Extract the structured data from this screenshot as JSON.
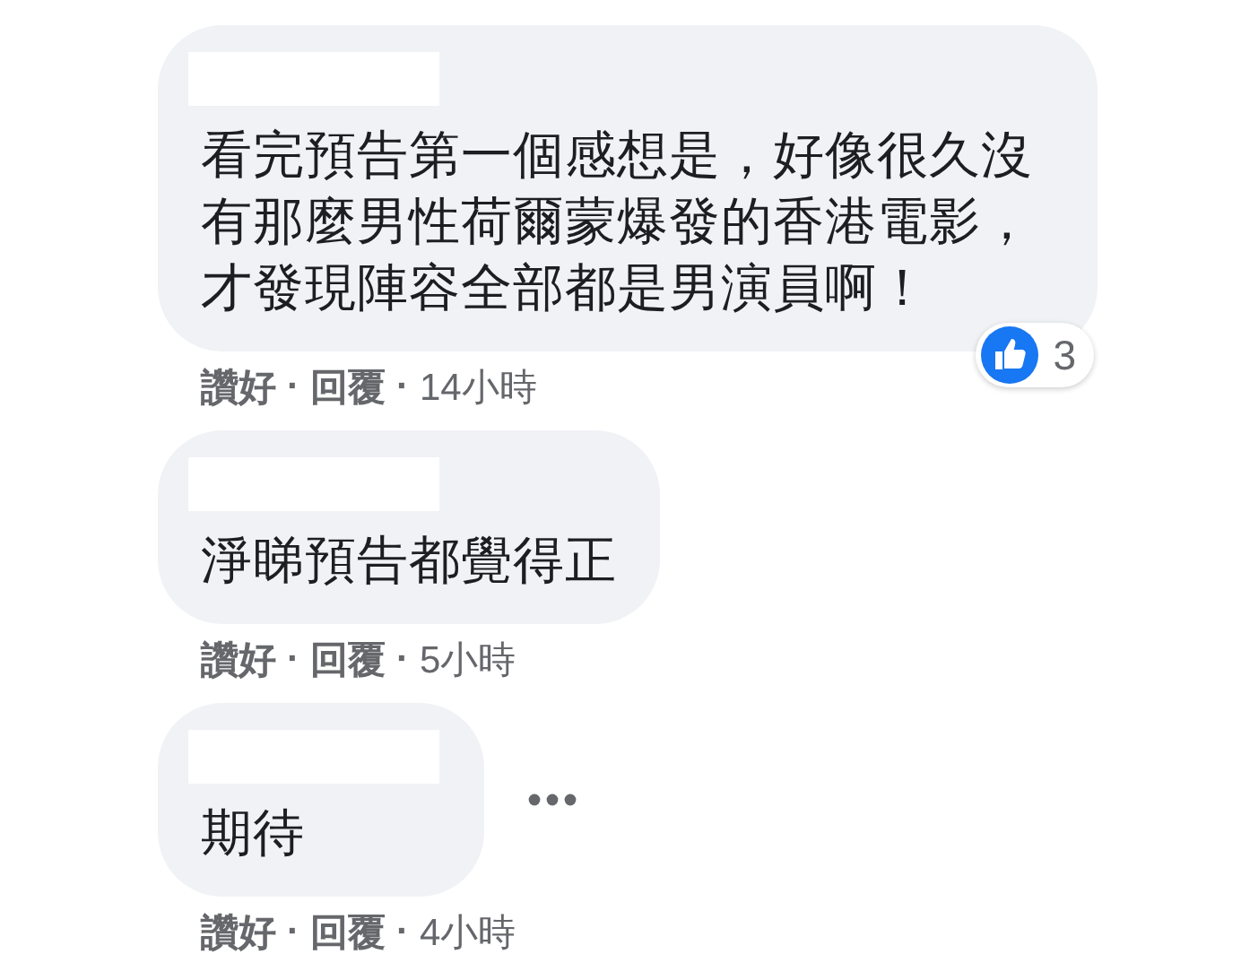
{
  "comments": [
    {
      "text": "看完預告第一個感想是，好像很久沒有那麼男性荷爾蒙爆發的香港電影，才發現陣容全部都是男演員啊！",
      "reactions": {
        "count": "3"
      },
      "more_button": false,
      "meta": {
        "like": "讚好",
        "separator": "·",
        "reply": "回覆",
        "time": "14小時"
      }
    },
    {
      "text": "淨睇預告都覺得正",
      "more_button": false,
      "meta": {
        "like": "讚好",
        "separator": "·",
        "reply": "回覆",
        "time": "5小時"
      }
    },
    {
      "text": "期待",
      "more_button": true,
      "meta": {
        "like": "讚好",
        "separator": "·",
        "reply": "回覆",
        "time": "4小時"
      }
    }
  ]
}
